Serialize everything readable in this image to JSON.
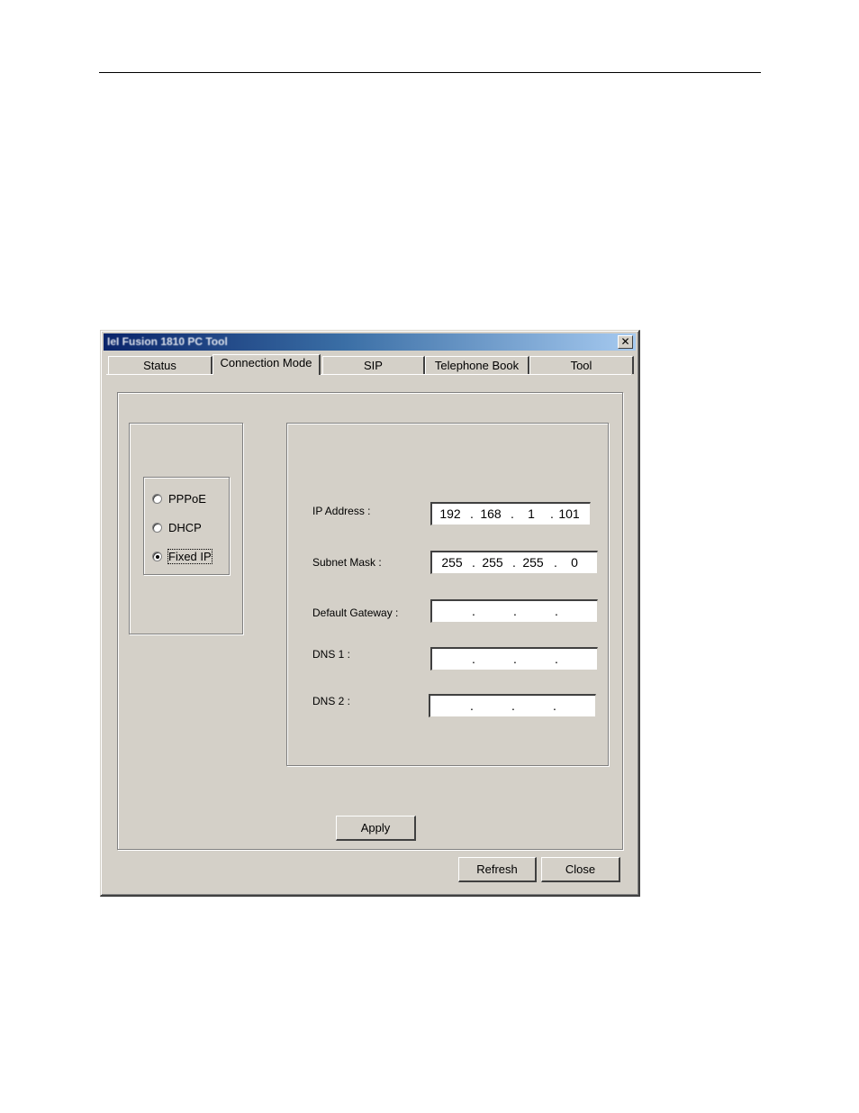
{
  "window": {
    "title": "IeI Fusion 1810 PC Tool",
    "close_glyph": "✕"
  },
  "tabs": [
    {
      "label": "Status"
    },
    {
      "label": "Connection Mode"
    },
    {
      "label": "SIP"
    },
    {
      "label": "Telephone Book"
    },
    {
      "label": "Tool"
    }
  ],
  "active_tab": "Connection Mode",
  "connection_mode": {
    "options": [
      {
        "label": "PPPoE",
        "selected": false
      },
      {
        "label": "DHCP",
        "selected": false
      },
      {
        "label": "Fixed IP",
        "selected": true
      }
    ]
  },
  "fields": {
    "ip_address": {
      "label": "IP Address :",
      "octets": [
        "192",
        "168",
        "1",
        "101"
      ]
    },
    "subnet_mask": {
      "label": "Subnet Mask :",
      "octets": [
        "255",
        "255",
        "255",
        "0"
      ]
    },
    "default_gateway": {
      "label": "Default Gateway :",
      "octets": [
        "",
        "",
        "",
        ""
      ]
    },
    "dns1": {
      "label": "DNS 1 :",
      "octets": [
        "",
        "",
        "",
        ""
      ]
    },
    "dns2": {
      "label": "DNS 2 :",
      "octets": [
        "",
        "",
        "",
        ""
      ]
    }
  },
  "buttons": {
    "apply": "Apply",
    "refresh": "Refresh",
    "close": "Close"
  }
}
